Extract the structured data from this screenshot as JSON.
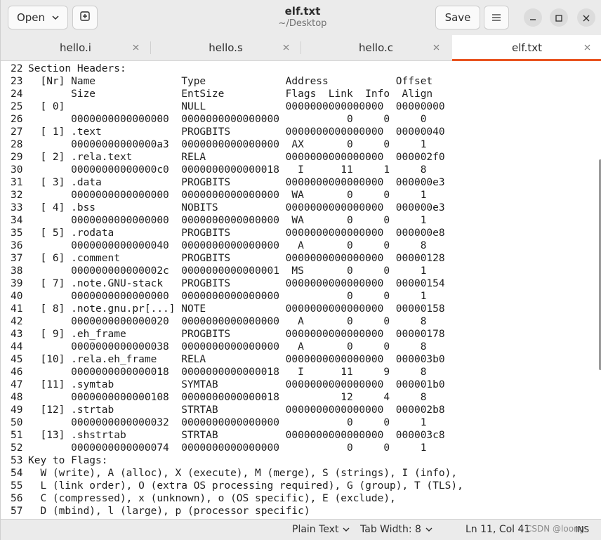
{
  "header": {
    "open_label": "Open",
    "save_label": "Save",
    "title": "elf.txt",
    "subtitle": "~/Desktop"
  },
  "tabs": [
    {
      "label": "hello.i",
      "active": false
    },
    {
      "label": "hello.s",
      "active": false
    },
    {
      "label": "hello.c",
      "active": false
    },
    {
      "label": "elf.txt",
      "active": true
    }
  ],
  "editor": {
    "lines": [
      {
        "num": "22",
        "text": "Section Headers:"
      },
      {
        "num": "23",
        "text": "  [Nr] Name              Type             Address           Offset"
      },
      {
        "num": "24",
        "text": "       Size              EntSize          Flags  Link  Info  Align"
      },
      {
        "num": "25",
        "text": "  [ 0]                   NULL             0000000000000000  00000000"
      },
      {
        "num": "26",
        "text": "       0000000000000000  0000000000000000           0     0     0"
      },
      {
        "num": "27",
        "text": "  [ 1] .text             PROGBITS         0000000000000000  00000040"
      },
      {
        "num": "28",
        "text": "       00000000000000a3  0000000000000000  AX       0     0     1"
      },
      {
        "num": "29",
        "text": "  [ 2] .rela.text        RELA             0000000000000000  000002f0"
      },
      {
        "num": "30",
        "text": "       00000000000000c0  0000000000000018   I      11     1     8"
      },
      {
        "num": "31",
        "text": "  [ 3] .data             PROGBITS         0000000000000000  000000e3"
      },
      {
        "num": "32",
        "text": "       0000000000000000  0000000000000000  WA       0     0     1"
      },
      {
        "num": "33",
        "text": "  [ 4] .bss              NOBITS           0000000000000000  000000e3"
      },
      {
        "num": "34",
        "text": "       0000000000000000  0000000000000000  WA       0     0     1"
      },
      {
        "num": "35",
        "text": "  [ 5] .rodata           PROGBITS         0000000000000000  000000e8"
      },
      {
        "num": "36",
        "text": "       0000000000000040  0000000000000000   A       0     0     8"
      },
      {
        "num": "37",
        "text": "  [ 6] .comment          PROGBITS         0000000000000000  00000128"
      },
      {
        "num": "38",
        "text": "       000000000000002c  0000000000000001  MS       0     0     1"
      },
      {
        "num": "39",
        "text": "  [ 7] .note.GNU-stack   PROGBITS         0000000000000000  00000154"
      },
      {
        "num": "40",
        "text": "       0000000000000000  0000000000000000           0     0     1"
      },
      {
        "num": "41",
        "text": "  [ 8] .note.gnu.pr[...] NOTE             0000000000000000  00000158"
      },
      {
        "num": "42",
        "text": "       0000000000000020  0000000000000000   A       0     0     8"
      },
      {
        "num": "43",
        "text": "  [ 9] .eh_frame         PROGBITS         0000000000000000  00000178"
      },
      {
        "num": "44",
        "text": "       0000000000000038  0000000000000000   A       0     0     8"
      },
      {
        "num": "45",
        "text": "  [10] .rela.eh_frame    RELA             0000000000000000  000003b0"
      },
      {
        "num": "46",
        "text": "       0000000000000018  0000000000000018   I      11     9     8"
      },
      {
        "num": "47",
        "text": "  [11] .symtab           SYMTAB           0000000000000000  000001b0"
      },
      {
        "num": "48",
        "text": "       0000000000000108  0000000000000018          12     4     8"
      },
      {
        "num": "49",
        "text": "  [12] .strtab           STRTAB           0000000000000000  000002b8"
      },
      {
        "num": "50",
        "text": "       0000000000000032  0000000000000000           0     0     1"
      },
      {
        "num": "51",
        "text": "  [13] .shstrtab         STRTAB           0000000000000000  000003c8"
      },
      {
        "num": "52",
        "text": "       0000000000000074  0000000000000000           0     0     1"
      },
      {
        "num": "53",
        "text": "Key to Flags:"
      },
      {
        "num": "54",
        "text": "  W (write), A (alloc), X (execute), M (merge), S (strings), I (info),"
      },
      {
        "num": "55",
        "text": "  L (link order), O (extra OS processing required), G (group), T (TLS),"
      },
      {
        "num": "56",
        "text": "  C (compressed), x (unknown), o (OS specific), E (exclude),"
      },
      {
        "num": "57",
        "text": "  D (mbind), l (large), p (processor specific)"
      }
    ]
  },
  "status": {
    "language": "Plain Text",
    "tab_width": "Tab Width: 8",
    "cursor": "Ln 11, Col 41",
    "watermark": "CSDN @loong",
    "mode": "INS"
  },
  "colors": {
    "accent": "#e95420"
  }
}
